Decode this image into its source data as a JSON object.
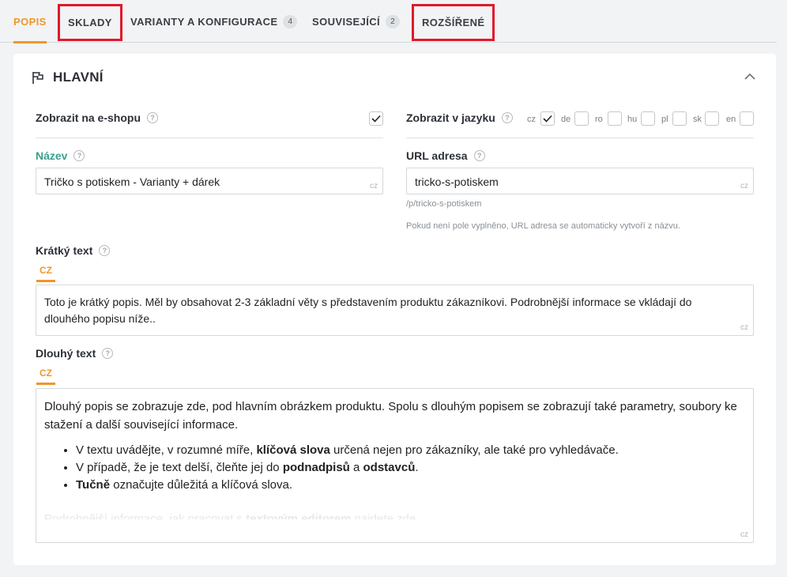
{
  "tabs": [
    {
      "label": "POPIS"
    },
    {
      "label": "SKLADY"
    },
    {
      "label": "VARIANTY A KONFIGURACE",
      "count": "4"
    },
    {
      "label": "SOUVISEJÍCÍ",
      "count": "2"
    },
    {
      "label": "ROZŠÍŘENÉ"
    }
  ],
  "section": {
    "title": "HLAVNÍ"
  },
  "show_eshop": {
    "label": "Zobrazit na e-shopu",
    "checked": true
  },
  "show_lang": {
    "label": "Zobrazit v jazyku",
    "langs": [
      {
        "code": "cz",
        "checked": true
      },
      {
        "code": "de",
        "checked": false
      },
      {
        "code": "ro",
        "checked": false
      },
      {
        "code": "hu",
        "checked": false
      },
      {
        "code": "pl",
        "checked": false
      },
      {
        "code": "sk",
        "checked": false
      },
      {
        "code": "en",
        "checked": false
      }
    ]
  },
  "name": {
    "label": "Název",
    "value": "Tričko s potiskem - Varianty + dárek",
    "lang": "cz"
  },
  "url": {
    "label": "URL adresa",
    "value": "tricko-s-potiskem",
    "lang": "cz",
    "preview": "/p/tricko-s-potiskem",
    "hint": "Pokud není pole vyplněno, URL adresa se automaticky vytvoří z názvu."
  },
  "short_text": {
    "label": "Krátký text",
    "lang_tab": "CZ",
    "value": "Toto je krátký popis. Měl by obsahovat 2-3 základní věty s představením produktu zákazníkovi. Podrobnější informace se vkládají do dlouhého popisu níže..",
    "lang": "cz"
  },
  "long_text": {
    "label": "Dlouhý text",
    "lang_tab": "CZ",
    "lang": "cz",
    "intro": "Dlouhý popis se zobrazuje zde, pod hlavním obrázkem produktu. Spolu s dlouhým popisem se zobrazují také parametry, soubory ke stažení a další související informace.",
    "b1_pre": "V textu uvádějte, v rozumné míře, ",
    "b1_bold": "klíčová slova",
    "b1_post": " určená nejen pro zákazníky, ale také pro vyhledávače.",
    "b2_pre": "V případě, že je text delší, čleňte jej do ",
    "b2_bold1": "podnadpisů",
    "b2_mid": " a ",
    "b2_bold2": "odstavců",
    "b2_post": ".",
    "b3_bold": "Tučně",
    "b3_post": " označujte důležitá a klíčová slova.",
    "fade_pre": "Podrobnější informace, jak pracovat s ",
    "fade_bold": "textovým editorem",
    "fade_post": " najdete zde"
  },
  "help_glyph": "?"
}
